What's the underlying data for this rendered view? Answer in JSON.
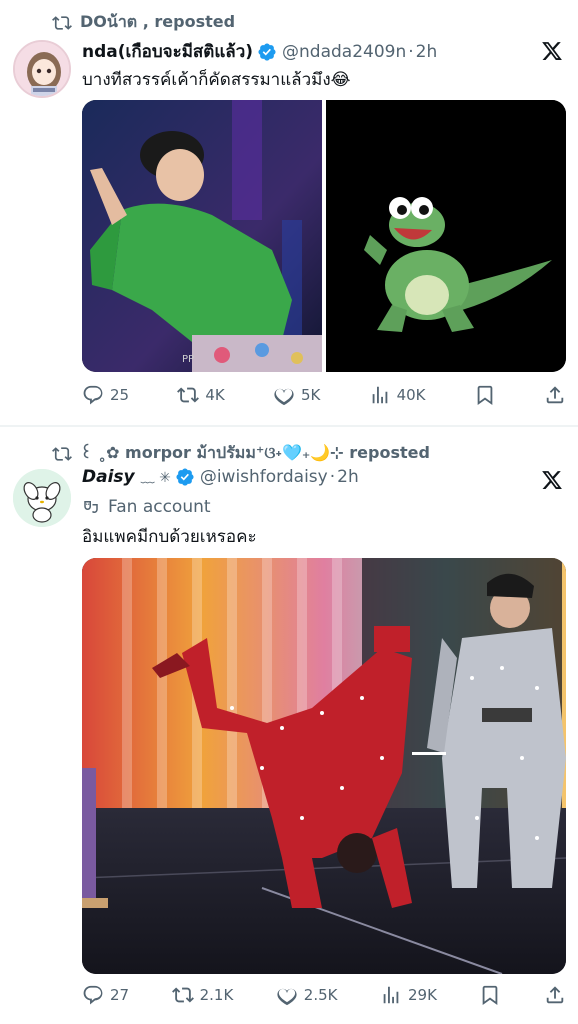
{
  "post1": {
    "repost_label": "DOน้าต , reposted",
    "author_name": "nda(เกือบจะมีสติแล้ว)",
    "handle": "@ndada2409n",
    "time": "2h",
    "text": "บางทีสวรรค์เค้าก็คัดสรรมาแล้วมึง😂",
    "image_watermark": "PP",
    "stats": {
      "replies": "25",
      "reposts": "4K",
      "likes": "5K",
      "views": "40K"
    }
  },
  "post2": {
    "repost_label": "꒰ ˳✿ morpor ม้าปรัมม⁺ଓ˖🩵₊🌙⊹ reposted",
    "author_name": "Daisy",
    "name_deco": "﹏ ✳︎",
    "handle": "@iwishfordaisy",
    "time": "2h",
    "label": "Fan account",
    "text": "อิมแพคมีกบด้วยเหรอคะ",
    "stats": {
      "replies": "27",
      "reposts": "2.1K",
      "likes": "2.5K",
      "views": "29K"
    }
  },
  "colors": {
    "text": "#0f1419",
    "secondary": "#536471",
    "verified": "#1d9bf0"
  }
}
